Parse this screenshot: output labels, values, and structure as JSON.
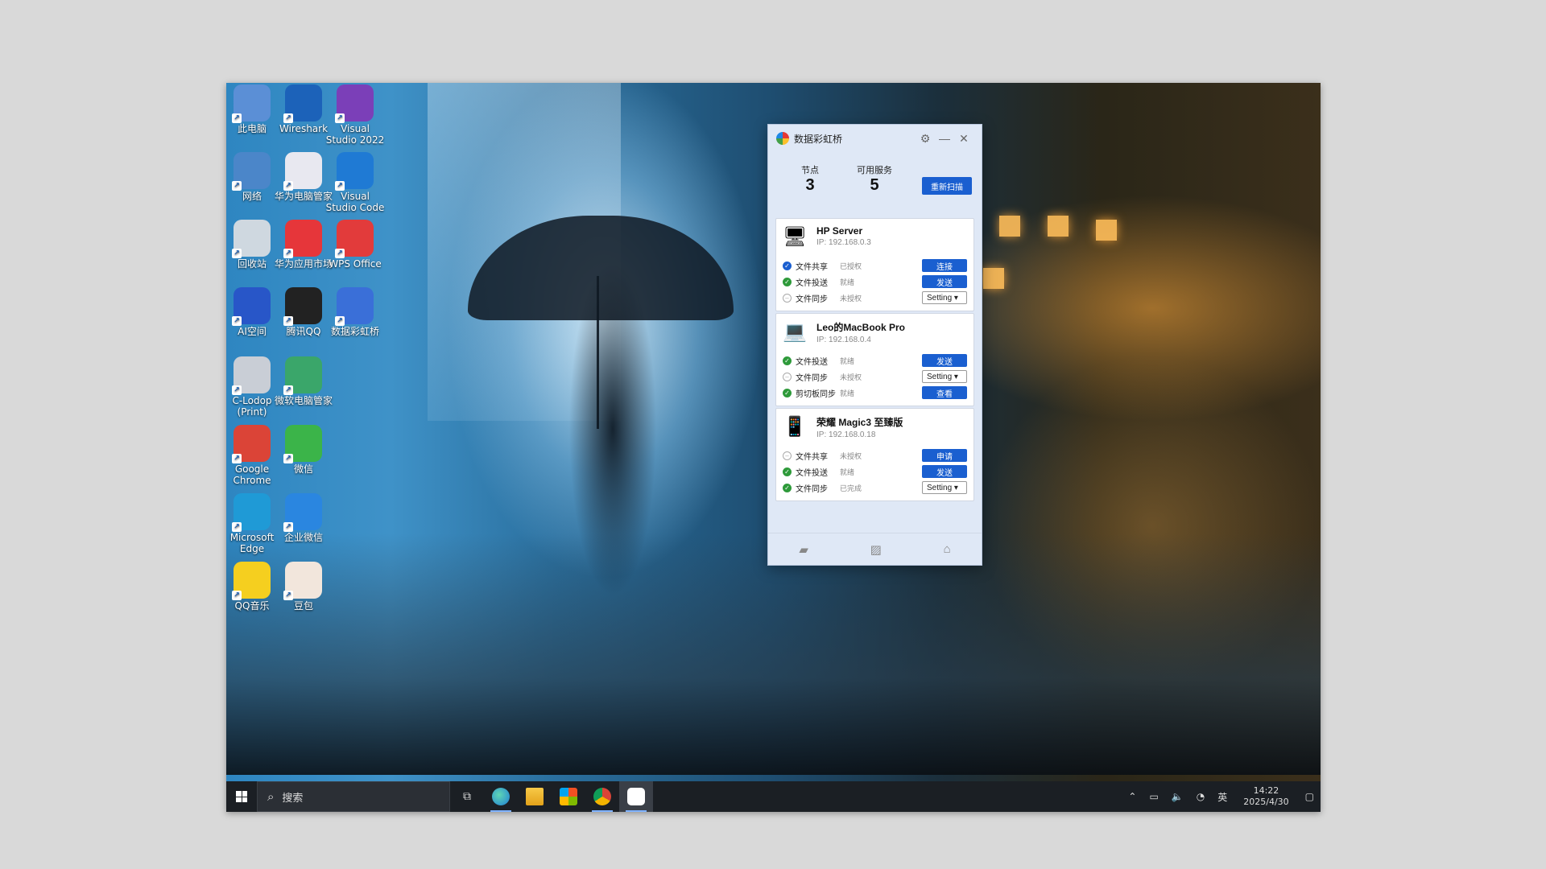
{
  "desktop": {
    "icons": [
      {
        "label": "此电脑",
        "icon": "computer-icon",
        "color": "#5b8fd6"
      },
      {
        "label": "Wireshark",
        "icon": "wireshark-icon",
        "color": "#1c62b9"
      },
      {
        "label": "Visual Studio 2022",
        "icon": "visual-studio-icon",
        "color": "#7b3fb8"
      },
      {
        "label": "网络",
        "icon": "network-icon",
        "color": "#4b86c9"
      },
      {
        "label": "华为电脑管家",
        "icon": "huawei-pc-manager-icon",
        "color": "#e8e8f0"
      },
      {
        "label": "Visual Studio Code",
        "icon": "vscode-icon",
        "color": "#1f7ad4"
      },
      {
        "label": "回收站",
        "icon": "recycle-bin-icon",
        "color": "#cfd8e0"
      },
      {
        "label": "华为应用市场",
        "icon": "huawei-appgallery-icon",
        "color": "#e6363a"
      },
      {
        "label": "WPS Office",
        "icon": "wps-icon",
        "color": "#e23b3b"
      },
      {
        "label": "AI空间",
        "icon": "ai-space-icon",
        "color": "#2856c8"
      },
      {
        "label": "腾讯QQ",
        "icon": "qq-icon",
        "color": "#222222"
      },
      {
        "label": "数据彩虹桥",
        "icon": "rainbow-bridge-icon",
        "color": "#3a6fd8"
      },
      {
        "label": "C-Lodop (Print)",
        "icon": "printer-icon",
        "color": "#c9ced6"
      },
      {
        "label": "微软电脑管家",
        "icon": "ms-pc-manager-icon",
        "color": "#3aa66a"
      },
      {
        "label": "Google Chrome",
        "icon": "chrome-icon",
        "color": "#db4437"
      },
      {
        "label": "微信",
        "icon": "wechat-icon",
        "color": "#3bb449"
      },
      {
        "label": "Microsoft Edge",
        "icon": "edge-icon",
        "color": "#1f9ad6"
      },
      {
        "label": "企业微信",
        "icon": "wecom-icon",
        "color": "#2a86e0"
      },
      {
        "label": "QQ音乐",
        "icon": "qq-music-icon",
        "color": "#f5cf1f"
      },
      {
        "label": "豆包",
        "icon": "doubao-icon",
        "color": "#f2e6dc"
      }
    ]
  },
  "app": {
    "title": "数据彩虹桥",
    "stats": {
      "nodes_label": "节点",
      "nodes_value": "3",
      "services_label": "可用服务",
      "services_value": "5"
    },
    "rescan_label": "重新扫描",
    "devices": [
      {
        "name": "HP Server",
        "ip": "IP: 192.168.0.3",
        "type": "server",
        "services": [
          {
            "name": "文件共享",
            "state": "已授权",
            "status": "auth",
            "action": "连接",
            "action_type": "button"
          },
          {
            "name": "文件投送",
            "state": "就绪",
            "status": "ready",
            "action": "发送",
            "action_type": "button"
          },
          {
            "name": "文件同步",
            "state": "未授权",
            "status": "none",
            "action": "Setting",
            "action_type": "setting"
          }
        ]
      },
      {
        "name": "Leo的MacBook Pro",
        "ip": "IP: 192.168.0.4",
        "type": "laptop",
        "services": [
          {
            "name": "文件投送",
            "state": "就绪",
            "status": "ready",
            "action": "发送",
            "action_type": "button"
          },
          {
            "name": "文件同步",
            "state": "未授权",
            "status": "none",
            "action": "Setting",
            "action_type": "setting"
          },
          {
            "name": "剪切板同步",
            "state": "就绪",
            "status": "ready",
            "action": "查看",
            "action_type": "button"
          }
        ]
      },
      {
        "name": "荣耀 Magic3 至臻版",
        "ip": "IP: 192.168.0.18",
        "type": "phone",
        "services": [
          {
            "name": "文件共享",
            "state": "未授权",
            "status": "none",
            "action": "申请",
            "action_type": "button"
          },
          {
            "name": "文件投送",
            "state": "就绪",
            "status": "ready",
            "action": "发送",
            "action_type": "button"
          },
          {
            "name": "文件同步",
            "state": "已完成",
            "status": "ready",
            "action": "Setting",
            "action_type": "setting"
          }
        ]
      }
    ]
  },
  "taskbar": {
    "search_placeholder": "搜索",
    "tray_lang": "英",
    "time": "14:22",
    "date": "2025/4/30"
  }
}
